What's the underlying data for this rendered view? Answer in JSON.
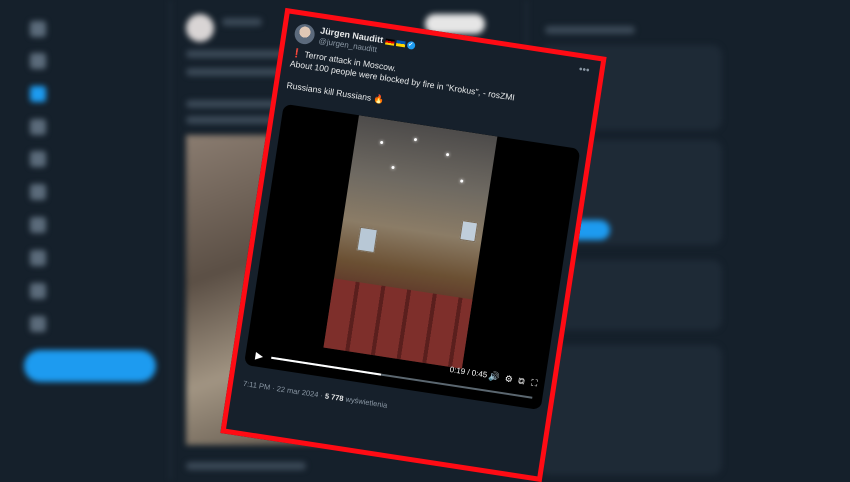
{
  "tweet": {
    "author_name": "Jürgen Nauditt",
    "author_handle": "@jurgen_nauditt",
    "more_icon": "more-icon",
    "text_line1": "Terror attack in Moscow.",
    "text_line2": "About 100 people were blocked by fire in \"Krokus\", - rosZMI",
    "text_line3": "Russians kill Russians",
    "exclaim_icon": "❗",
    "fire_icon": "🔥",
    "video": {
      "current_time": "0:19",
      "separator": " / ",
      "duration": "0:45",
      "progress": 0.42,
      "play_icon": "▶",
      "volume_icon": "🔊",
      "settings_icon": "⚙",
      "popout_icon": "⧉",
      "fullscreen_icon": "⛶"
    },
    "timestamp": "7:11 PM · 22 mar 2024 · ",
    "views": "5 778",
    "views_label": " wyświetlenia"
  },
  "colors": {
    "frame": "#ff0b14",
    "accent": "#1d9bf0",
    "background": "#15202b"
  }
}
